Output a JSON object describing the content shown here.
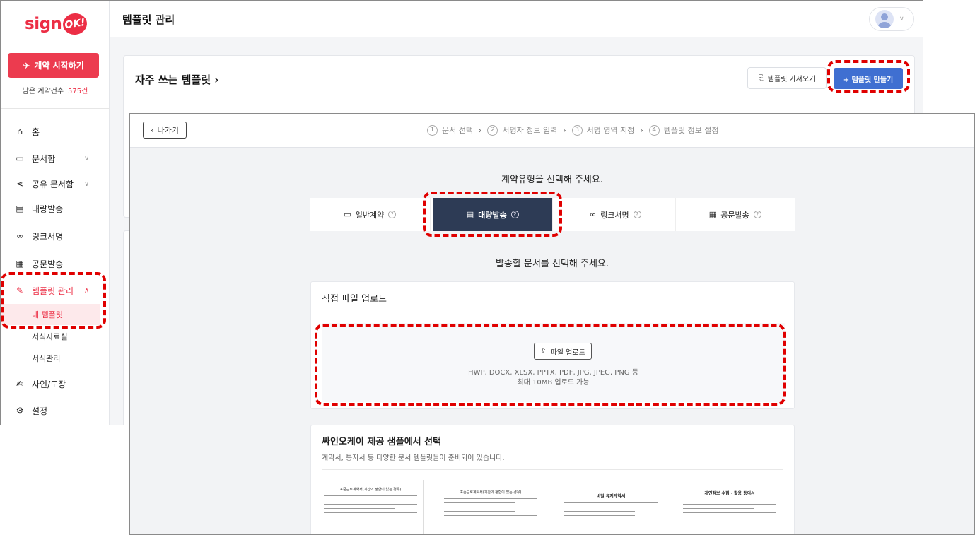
{
  "app": {
    "logo_text": "sign",
    "logo_badge": "OK!",
    "page_title": "템플릿 관리"
  },
  "sidebar": {
    "start_button": "계약 시작하기",
    "remaining_label": "남은 계약건수",
    "remaining_count": "575건",
    "items": [
      {
        "label": "홈",
        "icon": "home-icon"
      },
      {
        "label": "문서함",
        "icon": "folder-icon",
        "expandable": true
      },
      {
        "label": "공유 문서함",
        "icon": "share-icon",
        "expandable": true
      },
      {
        "label": "대량발송",
        "icon": "bulk-send-icon"
      },
      {
        "label": "링크서명",
        "icon": "link-icon"
      },
      {
        "label": "공문발송",
        "icon": "document-icon"
      },
      {
        "label": "템플릿 관리",
        "icon": "template-icon",
        "expanded": true,
        "active": true
      },
      {
        "label": "사인/도장",
        "icon": "signature-icon"
      },
      {
        "label": "설정",
        "icon": "gear-icon"
      }
    ],
    "subitems": [
      {
        "label": "내 템플릿",
        "active": true
      },
      {
        "label": "서식자료실"
      },
      {
        "label": "서식관리"
      }
    ]
  },
  "templates_panel": {
    "heading": "자주 쓰는 템플릿",
    "import_button": "템플릿 가져오기",
    "create_button": "+ 템플릿 만들기"
  },
  "wizard": {
    "back_button": "나가기",
    "steps": [
      {
        "num": "1",
        "label": "문서 선택"
      },
      {
        "num": "2",
        "label": "서명자 정보 입력"
      },
      {
        "num": "3",
        "label": "서명 영역 지정"
      },
      {
        "num": "4",
        "label": "템플릿 정보 설정"
      }
    ],
    "contract_type_prompt": "계약유형을 선택해 주세요.",
    "contract_types": [
      {
        "label": "일반계약",
        "icon": "folder-icon",
        "selected": false
      },
      {
        "label": "대량발송",
        "icon": "bulk-send-icon",
        "selected": true
      },
      {
        "label": "링크서명",
        "icon": "link-icon",
        "selected": false
      },
      {
        "label": "공문발송",
        "icon": "document-icon",
        "selected": false
      }
    ],
    "document_prompt": "발송할 문서를 선택해 주세요.",
    "upload": {
      "heading": "직접 파일 업로드",
      "button": "파일 업로드",
      "formats": "HWP, DOCX, XLSX, PPTX, PDF, JPG, JPEG, PNG 등",
      "limit": "최대 10MB 업로드 가능"
    },
    "samples": {
      "heading": "싸인오케이 제공 샘플에서 선택",
      "description": "계약서, 통지서 등 다양한 문서 템플릿들이 준비되어 있습니다.",
      "thumbnails": [
        "표준근로계약서(기간의 정함이 없는 경우)",
        "표준근로계약서(기간의 정함이 있는 경우)",
        "비밀 유지계약서",
        "개인정보 수집 · 활용 동의서"
      ]
    },
    "question_mark": "?"
  },
  "colors": {
    "brand": "#ec2e45",
    "selected_type": "#2d3b55",
    "primary_button": "#3f6fd1",
    "highlight": "#e00000"
  }
}
